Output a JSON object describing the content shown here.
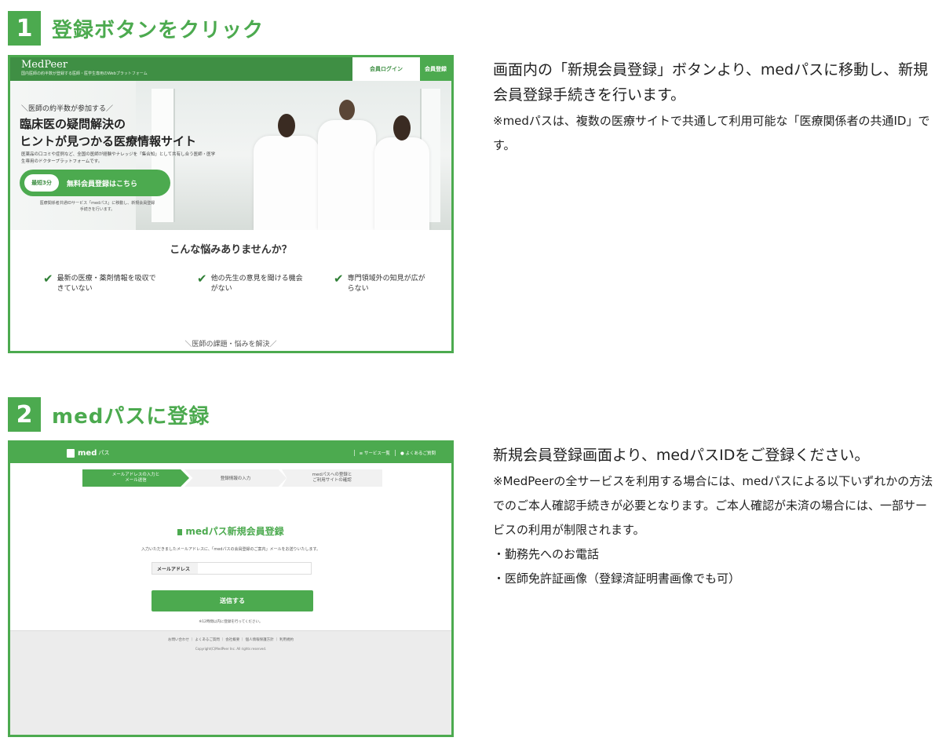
{
  "step1": {
    "number": "1",
    "title": "登録ボタンをクリック",
    "desc_main": "画面内の「新規会員登録」ボタンより、medパスに移動し、新規会員登録手続きを行います。",
    "desc_note": "※medパスは、複数の医療サイトで共通して利用可能な「医療関係者の共通ID」です。",
    "screenshot": {
      "logo": "MedPeer",
      "logo_sub": "国内医師の約半数が登録する医師・医学生専用のWebプラットフォーム",
      "login_label": "会員ログイン",
      "register_label": "会員登録",
      "tagline": "＼医師の約半数が参加する／",
      "headline_line1": "臨床医の疑問解決の",
      "headline_line2": "ヒントが見つかる医療情報サイト",
      "body_text": "医薬品の口コミや症例など、全国の医師が経験やナレッジを「集合知」として共有し合う医師・医学生専用のドクタープラットフォームです。",
      "cta_badge": "最短3分",
      "cta_label": "無料会員登録はこちら",
      "cta_note": "医療関係者共通IDサービス「medパス」に移動し、新規会員登録手続きを行います。",
      "question": "こんな悩みありませんか？",
      "checks": [
        "最新の医療・薬剤情報を吸収できていない",
        "他の先生の意見を聞ける機会がない",
        "専門領域外の知見が広がらない"
      ],
      "bottom_text": "＼医師の課題・悩みを解決／"
    }
  },
  "step2": {
    "number": "2",
    "title": "medパスに登録",
    "desc_main": "新規会員登録画面より、medパスIDをご登録ください。",
    "desc_note": "※MedPeerの全サービスを利用する場合には、medパスによる以下いずれかの方法でのご本人確認手続きが必要となります。ご本人確認が未済の場合には、一部サービスの利用が制限されます。",
    "desc_items": [
      "・勤務先へのお電話",
      "・医師免許証画像（登録済証明書画像でも可）"
    ],
    "screenshot": {
      "logo": "med",
      "logo_suffix": "パス",
      "nav": [
        "≡ サービス一覧",
        "● よくあるご質問"
      ],
      "steps": [
        "メールアドレスの入力と\nメール送信",
        "登録情報の入力",
        "medパスへの登録と\nご利用サイトの確認"
      ],
      "title": "medパス新規会員登録",
      "info": "入力いただきましたメールアドレスに、「medパスの会員登録のご案内」メールをお送りいたします。",
      "email_label": "メールアドレス",
      "submit_label": "送信する",
      "note": "※12時間以内に登録を行ってください。",
      "footer_links": "お問い合わせ ｜ よくあるご質問 ｜ 会社概要 ｜ 個人情報保護方針 ｜ 利用規約",
      "copyright": "Copyright(C)MedPeer Inc. All rights reserved."
    }
  },
  "colors": {
    "accent": "#4caa4f",
    "accent_dark": "#3f8f44"
  }
}
